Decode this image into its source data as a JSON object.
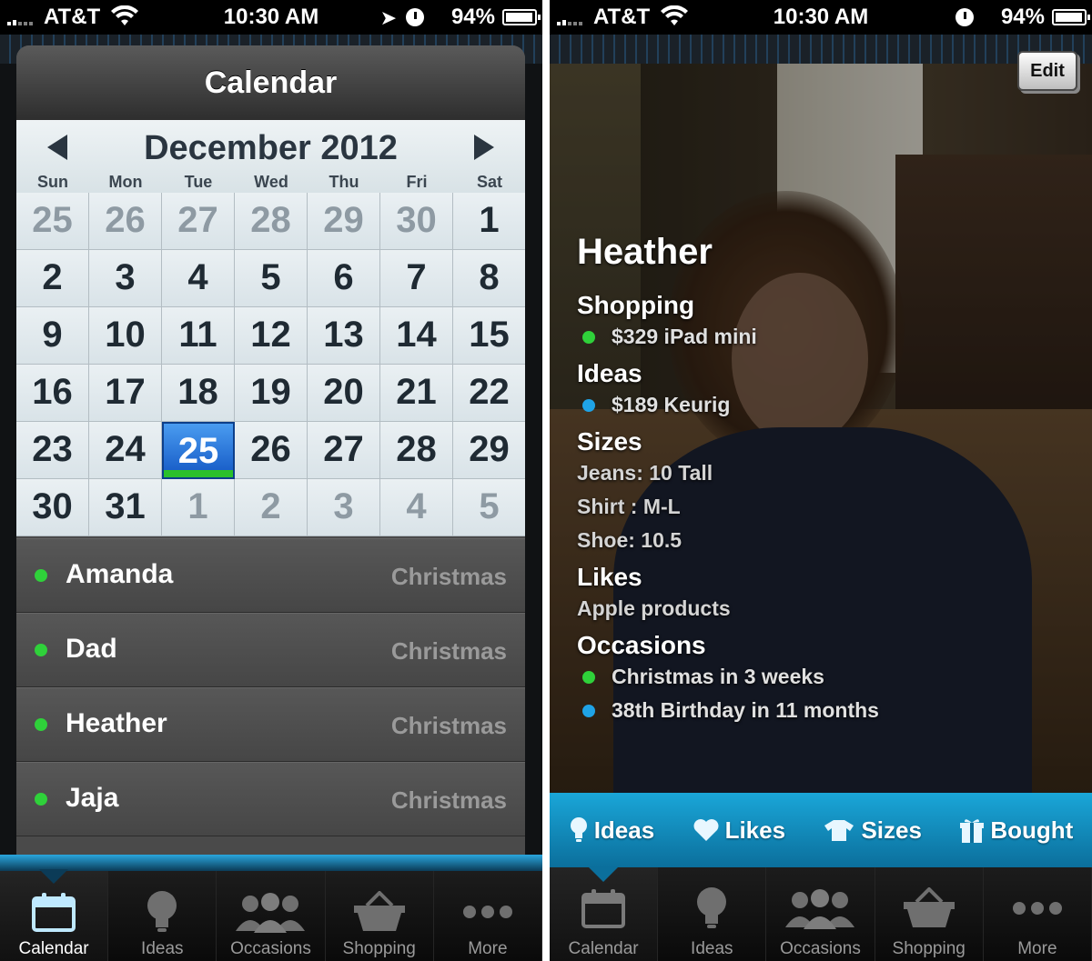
{
  "status_bar": {
    "carrier": "AT&T",
    "time": "10:30 AM",
    "battery": "94%"
  },
  "left": {
    "title": "Calendar",
    "month": "December 2012",
    "weekdays": [
      "Sun",
      "Mon",
      "Tue",
      "Wed",
      "Thu",
      "Fri",
      "Sat"
    ],
    "days": [
      {
        "n": "25",
        "other": true
      },
      {
        "n": "26",
        "other": true
      },
      {
        "n": "27",
        "other": true
      },
      {
        "n": "28",
        "other": true
      },
      {
        "n": "29",
        "other": true
      },
      {
        "n": "30",
        "other": true
      },
      {
        "n": "1"
      },
      {
        "n": "2"
      },
      {
        "n": "3"
      },
      {
        "n": "4"
      },
      {
        "n": "5"
      },
      {
        "n": "6"
      },
      {
        "n": "7"
      },
      {
        "n": "8"
      },
      {
        "n": "9"
      },
      {
        "n": "10"
      },
      {
        "n": "11"
      },
      {
        "n": "12"
      },
      {
        "n": "13"
      },
      {
        "n": "14"
      },
      {
        "n": "15"
      },
      {
        "n": "16"
      },
      {
        "n": "17"
      },
      {
        "n": "18"
      },
      {
        "n": "19"
      },
      {
        "n": "20"
      },
      {
        "n": "21"
      },
      {
        "n": "22"
      },
      {
        "n": "23"
      },
      {
        "n": "24"
      },
      {
        "n": "25",
        "today": true
      },
      {
        "n": "26"
      },
      {
        "n": "27"
      },
      {
        "n": "28"
      },
      {
        "n": "29"
      },
      {
        "n": "30"
      },
      {
        "n": "31"
      },
      {
        "n": "1",
        "other": true
      },
      {
        "n": "2",
        "other": true
      },
      {
        "n": "3",
        "other": true
      },
      {
        "n": "4",
        "other": true
      },
      {
        "n": "5",
        "other": true
      }
    ],
    "events": [
      {
        "name": "Amanda",
        "occasion": "Christmas"
      },
      {
        "name": "Dad",
        "occasion": "Christmas"
      },
      {
        "name": "Heather",
        "occasion": "Christmas"
      },
      {
        "name": "Jaja",
        "occasion": "Christmas"
      }
    ]
  },
  "tabs": {
    "calendar": "Calendar",
    "ideas": "Ideas",
    "occasions": "Occasions",
    "shopping": "Shopping",
    "more": "More"
  },
  "right": {
    "edit": "Edit",
    "name": "Heather",
    "shopping_title": "Shopping",
    "shopping_item": "$329 iPad mini",
    "ideas_title": "Ideas",
    "ideas_item": "$189 Keurig",
    "sizes_title": "Sizes",
    "size_jeans": "Jeans: 10 Tall",
    "size_shirt": "Shirt : M-L",
    "size_shoe": "Shoe: 10.5",
    "likes_title": "Likes",
    "likes_item": "Apple products",
    "occasions_title": "Occasions",
    "occasion_1": "Christmas in 3 weeks",
    "occasion_2": "38th Birthday in 11 months",
    "actions": {
      "ideas": "Ideas",
      "likes": "Likes",
      "sizes": "Sizes",
      "bought": "Bought"
    }
  },
  "colors": {
    "green_dot": "#2fd13a",
    "blue_dot": "#1fa3e6",
    "accent": "#1aa6d8"
  }
}
